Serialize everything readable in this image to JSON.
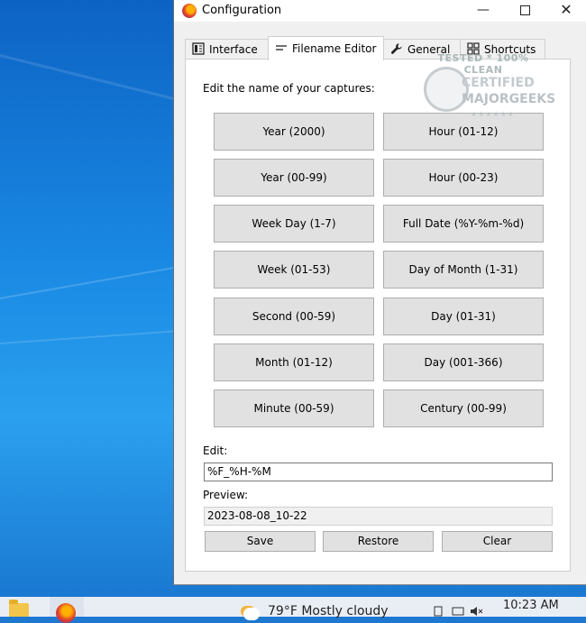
{
  "window": {
    "title": "Configuration",
    "controls": {
      "minimize": "—",
      "maximize": "",
      "close": "✕"
    }
  },
  "tabs": [
    {
      "label": "Interface",
      "icon": "interface-icon",
      "active": false
    },
    {
      "label": "Filename Editor",
      "icon": "lines-icon",
      "active": true
    },
    {
      "label": "General",
      "icon": "wrench-icon",
      "active": false
    },
    {
      "label": "Shortcuts",
      "icon": "grid-icon",
      "active": false
    }
  ],
  "editor": {
    "intro": "Edit the name of your captures:",
    "buttons": [
      [
        "Year (2000)",
        "Hour (01-12)"
      ],
      [
        "Year (00-99)",
        "Hour (00-23)"
      ],
      [
        "Week Day (1-7)",
        "Full Date (%Y-%m-%d)"
      ],
      [
        "Week (01-53)",
        "Day of Month (1-31)"
      ],
      [
        "Second (00-59)",
        "Day (01-31)"
      ],
      [
        "Month (01-12)",
        "Day (001-366)"
      ],
      [
        "Minute (00-59)",
        "Century (00-99)"
      ]
    ],
    "edit_label": "Edit:",
    "edit_value": "%F_%H-%M",
    "preview_label": "Preview:",
    "preview_value": "2023-08-08_10-22",
    "actions": {
      "save": "Save",
      "restore": "Restore",
      "clear": "Clear"
    }
  },
  "watermark": {
    "top": "TESTED * 100% CLEAN",
    "certified": "CERTIFIED",
    "brand": "MAJORGEEKS",
    "stars": "★★★★★★"
  },
  "taskbar": {
    "weather": "79°F  Mostly cloudy",
    "clock": "10:23 AM"
  }
}
